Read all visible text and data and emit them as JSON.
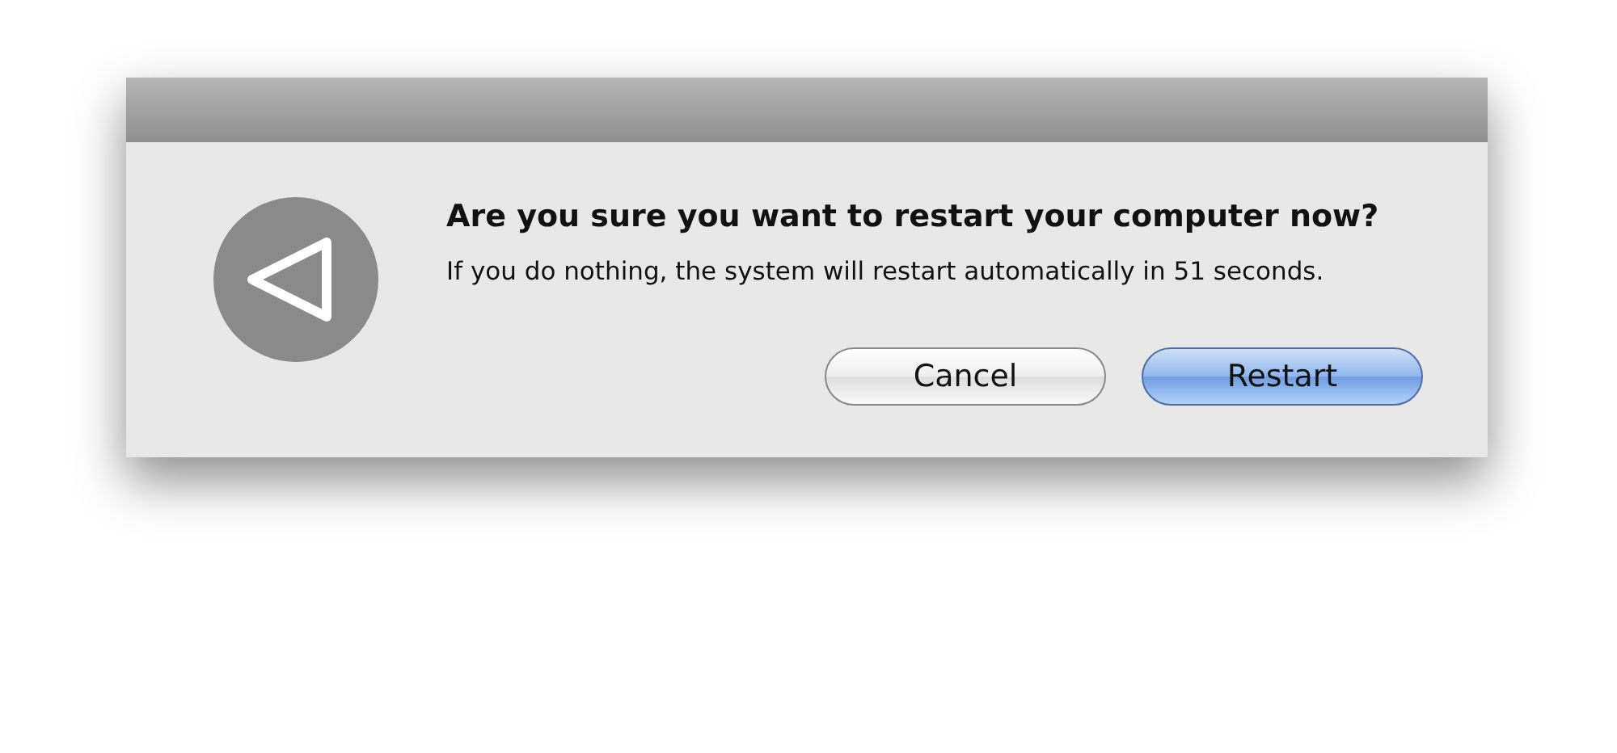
{
  "dialog": {
    "title": "Are you sure you want to restart your computer now?",
    "message": "If you do nothing, the system will restart automatically in 51 seconds.",
    "buttons": [
      {
        "label": "Cancel",
        "default": false
      },
      {
        "label": "Restart",
        "default": true
      }
    ]
  }
}
